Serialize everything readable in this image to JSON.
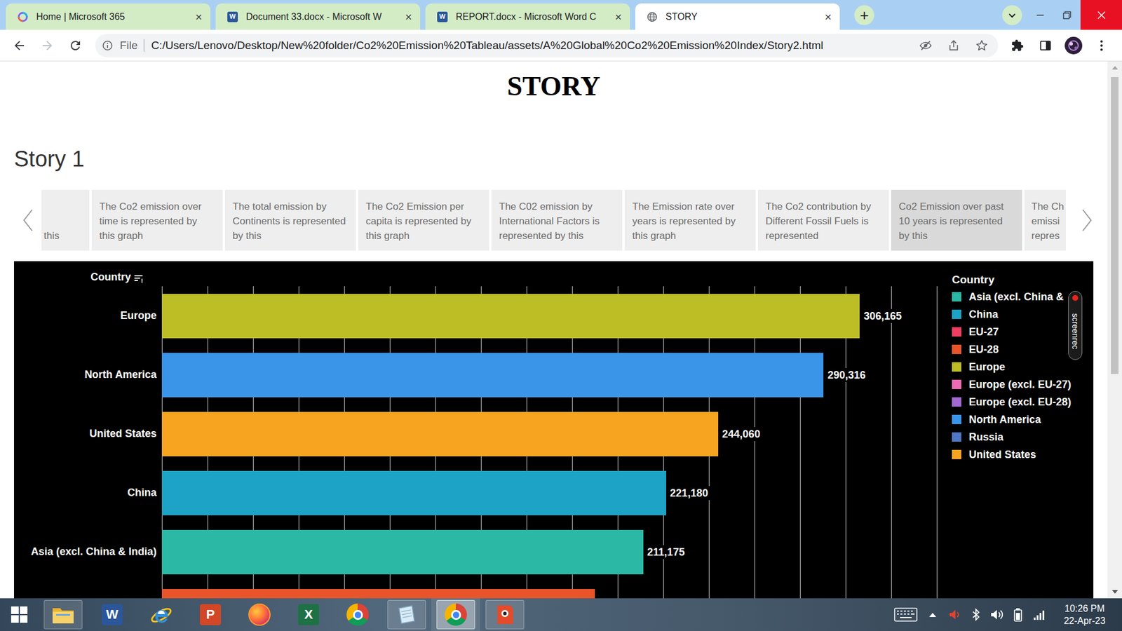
{
  "browser": {
    "tabs": [
      {
        "label": "Home | Microsoft 365",
        "selected": false,
        "kind": "m365",
        "close": "×"
      },
      {
        "label": "Document 33.docx - Microsoft W",
        "selected": false,
        "kind": "word",
        "glyph": "W",
        "close": "×"
      },
      {
        "label": "REPORT.docx - Microsoft Word C",
        "selected": false,
        "kind": "word",
        "glyph": "W",
        "close": "×"
      },
      {
        "label": "STORY",
        "selected": true,
        "kind": "globe",
        "close": "×"
      }
    ],
    "new_tab": "+",
    "address": {
      "scheme": "File",
      "url": "C:/Users/Lenovo/Desktop/New%20folder/Co2%20Emission%20Tableau/assets/A%20Global%20Co2%20Emission%20Index/Story2.html"
    }
  },
  "page": {
    "heading": "STORY",
    "story_title": "Story 1",
    "story_points": [
      {
        "text": "this",
        "kind": "tail",
        "selected": false
      },
      {
        "text": "The Co2 emission over time is represented by this graph",
        "kind": "full",
        "selected": false
      },
      {
        "text": "The total emission by Continents is represented by this",
        "kind": "full",
        "selected": false
      },
      {
        "text": "The Co2 Emission per capita is represented by this graph",
        "kind": "full",
        "selected": false
      },
      {
        "text": "The C02 emission by International Factors is represented by this",
        "kind": "full",
        "selected": false
      },
      {
        "text": "The Emission rate over years is represented by this graph",
        "kind": "full",
        "selected": false
      },
      {
        "text": "The Co2 contribution by Different Fossil Fuels is represented",
        "kind": "full",
        "selected": false
      },
      {
        "text": "Co2 Emission over past 10 years is represented by this",
        "kind": "full",
        "selected": true
      },
      {
        "text": "The Ch emissi repres",
        "kind": "head",
        "selected": false
      }
    ],
    "chart": {
      "axis_title": "Country",
      "axis": {
        "min": 0,
        "max": 340000,
        "step": 20000
      },
      "bars": [
        {
          "label": "Europe",
          "value": 306165,
          "value_text": "306,165",
          "color": "#bdbe26"
        },
        {
          "label": "North America",
          "value": 290316,
          "value_text": "290,316",
          "color": "#3a95e8"
        },
        {
          "label": "United States",
          "value": 244060,
          "value_text": "244,060",
          "color": "#f7a520"
        },
        {
          "label": "China",
          "value": 221180,
          "value_text": "221,180",
          "color": "#1ca3c6"
        },
        {
          "label": "Asia (excl. China & India)",
          "value": 211175,
          "value_text": "211,175",
          "color": "#2bb8a5"
        },
        {
          "value": 190000,
          "color": "#e8552a"
        }
      ],
      "legend": {
        "title": "Country",
        "items": [
          {
            "label": "Asia (excl. China &",
            "color": "#2bb8a5"
          },
          {
            "label": "China",
            "color": "#1ca3c6"
          },
          {
            "label": "EU-27",
            "color": "#f03e62"
          },
          {
            "label": "EU-28",
            "color": "#e8552a"
          },
          {
            "label": "Europe",
            "color": "#bdbe26"
          },
          {
            "label": "Europe (excl. EU-27)",
            "color": "#ee6cb4"
          },
          {
            "label": "Europe (excl. EU-28)",
            "color": "#a569d3"
          },
          {
            "label": "North America",
            "color": "#3a95e8"
          },
          {
            "label": "Russia",
            "color": "#4f78c4"
          },
          {
            "label": "United States",
            "color": "#f7a520"
          }
        ]
      }
    }
  },
  "overlay": {
    "text": "screenrec"
  },
  "taskbar": {
    "apps": [
      {
        "kind": "explorer",
        "running": true,
        "selected": false
      },
      {
        "kind": "word",
        "glyph": "W",
        "running": false,
        "selected": false
      },
      {
        "kind": "ie",
        "running": false,
        "selected": false
      },
      {
        "kind": "powerpoint",
        "glyph": "P",
        "running": false,
        "selected": false
      },
      {
        "kind": "firefox",
        "running": false,
        "selected": false
      },
      {
        "kind": "excel",
        "glyph": "X",
        "running": false,
        "selected": false
      },
      {
        "kind": "chrome",
        "running": false,
        "selected": false
      },
      {
        "kind": "notes",
        "running": true,
        "selected": false
      },
      {
        "kind": "chrome",
        "running": true,
        "selected": true
      },
      {
        "kind": "red-app",
        "running": true,
        "selected": false
      }
    ],
    "clock": {
      "time": "10:26 PM",
      "date": "22-Apr-23"
    }
  }
}
